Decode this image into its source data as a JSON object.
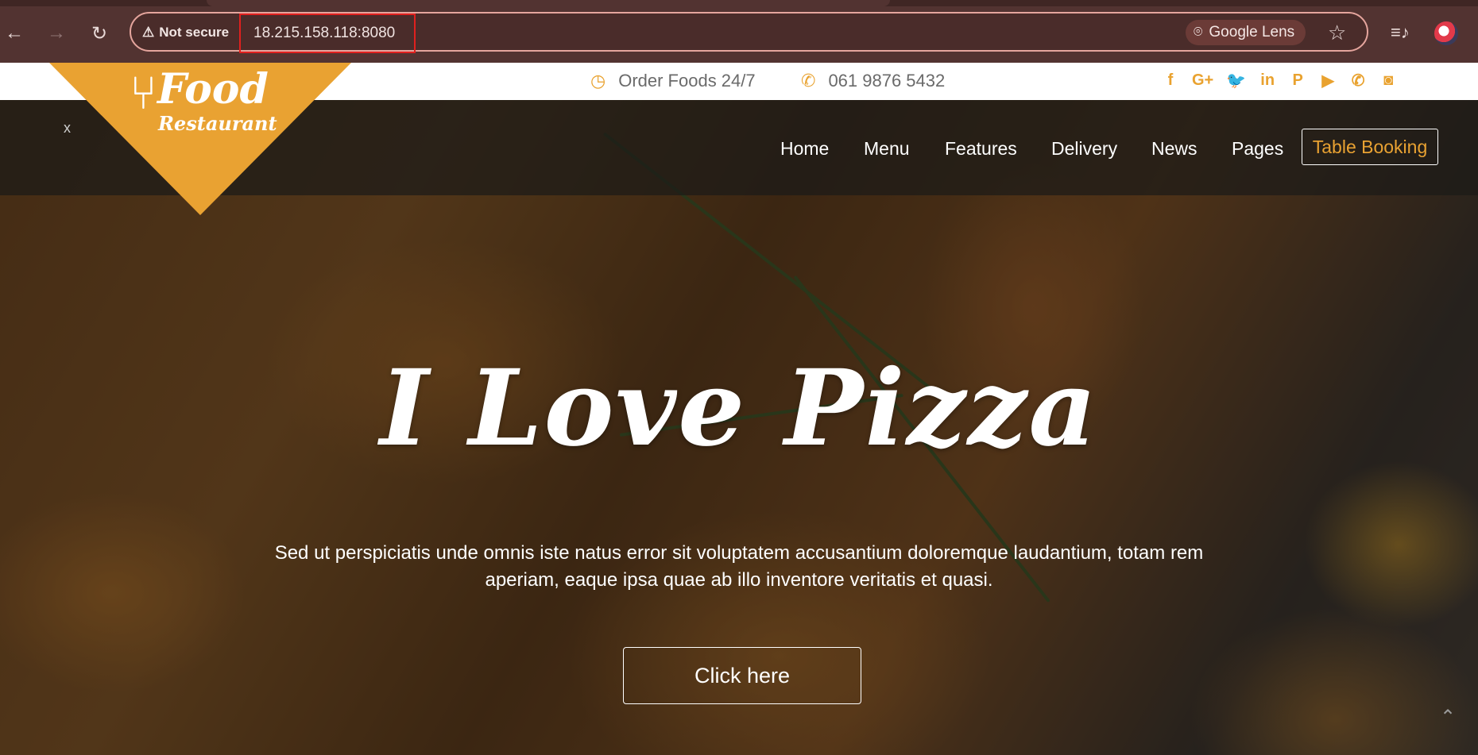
{
  "browser": {
    "security_label": "Not secure",
    "url": "18.215.158.118:8080",
    "lens_label": "Google Lens"
  },
  "topbar": {
    "order_text": "Order Foods 24/7",
    "phone": "061 9876 5432",
    "socials": [
      {
        "name": "facebook-icon",
        "glyph": "f"
      },
      {
        "name": "google-plus-icon",
        "glyph": "G+"
      },
      {
        "name": "twitter-icon",
        "glyph": "🐦"
      },
      {
        "name": "linkedin-icon",
        "glyph": "in"
      },
      {
        "name": "pinterest-icon",
        "glyph": "P"
      },
      {
        "name": "youtube-icon",
        "glyph": "▶"
      },
      {
        "name": "phone-icon",
        "glyph": "✆"
      },
      {
        "name": "instagram-icon",
        "glyph": "◙"
      }
    ]
  },
  "logo": {
    "title": "Food",
    "subtitle": "Restaurant"
  },
  "close_label": "x",
  "nav": {
    "items": [
      "Home",
      "Menu",
      "Features",
      "Delivery",
      "News",
      "Pages"
    ],
    "booking": "Table Booking"
  },
  "hero": {
    "title": "I Love Pizza",
    "text": "Sed ut perspiciatis unde omnis iste natus error sit voluptatem accusantium doloremque laudantium, totam rem aperiam, eaque ipsa quae ab illo inventore veritatis et quasi.",
    "button": "Click here"
  },
  "colors": {
    "accent": "#e9a232",
    "chrome": "#523331",
    "url_highlight": "#e0201e"
  }
}
